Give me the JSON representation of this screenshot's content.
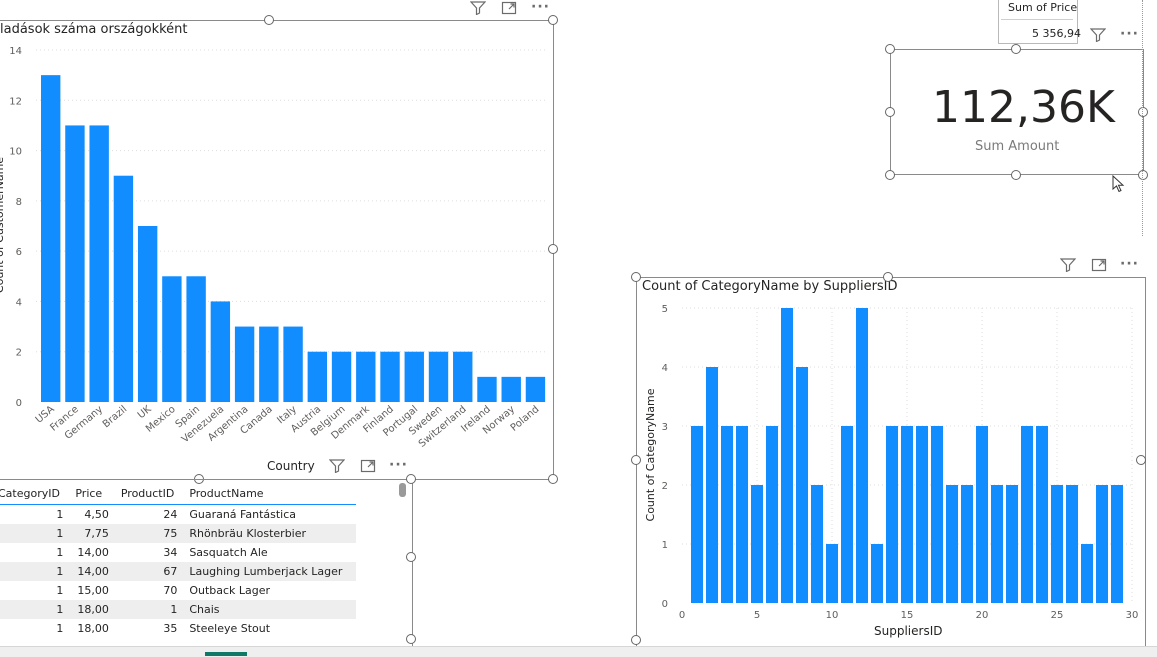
{
  "colors": {
    "bar": "#118dff",
    "accent": "#118dff"
  },
  "left_chart": {
    "title": "ladások száma országokként",
    "xlabel": "Country",
    "ylabel": "Count of CustomerName"
  },
  "kpi": {
    "value": "112,36K",
    "label": "Sum Amount"
  },
  "price_card": {
    "header": "Sum of Price",
    "value": "5 356,94"
  },
  "right_chart": {
    "title": "Count of CategoryName by SuppliersID",
    "xlabel": "SuppliersID",
    "ylabel": "Count of CategoryName"
  },
  "table": {
    "headers": [
      "CategoryID",
      "Price",
      "ProductID",
      "ProductName"
    ],
    "rows": [
      [
        "1",
        "4,50",
        "24",
        "Guaraná Fantástica"
      ],
      [
        "1",
        "7,75",
        "75",
        "Rhönbräu Klosterbier"
      ],
      [
        "1",
        "14,00",
        "34",
        "Sasquatch Ale"
      ],
      [
        "1",
        "14,00",
        "67",
        "Laughing Lumberjack Lager"
      ],
      [
        "1",
        "15,00",
        "70",
        "Outback Lager"
      ],
      [
        "1",
        "18,00",
        "1",
        "Chais"
      ],
      [
        "1",
        "18,00",
        "35",
        "Steeleye Stout"
      ]
    ]
  },
  "icons": [
    "filter-icon",
    "focus-mode-icon",
    "more-options-icon",
    "mouse-cursor-icon"
  ],
  "chart_data": [
    {
      "type": "bar",
      "title": "ladások száma országokként",
      "xlabel": "Country",
      "ylabel": "Count of CustomerName",
      "categories": [
        "USA",
        "France",
        "Germany",
        "Brazil",
        "UK",
        "Mexico",
        "Spain",
        "Venezuela",
        "Argentina",
        "Canada",
        "Italy",
        "Austria",
        "Belgium",
        "Denmark",
        "Finland",
        "Portugal",
        "Sweden",
        "Switzerland",
        "Ireland",
        "Norway",
        "Poland"
      ],
      "values": [
        13,
        11,
        11,
        9,
        7,
        5,
        5,
        4,
        3,
        3,
        3,
        2,
        2,
        2,
        2,
        2,
        2,
        2,
        1,
        1,
        1
      ],
      "ylim": [
        0,
        14
      ],
      "yticks": [
        0,
        2,
        4,
        6,
        8,
        10,
        12,
        14
      ],
      "grid": true
    },
    {
      "type": "bar",
      "title": "Count of CategoryName by SuppliersID",
      "xlabel": "SuppliersID",
      "ylabel": "Count of CategoryName",
      "x": [
        1,
        2,
        3,
        4,
        5,
        6,
        7,
        8,
        9,
        10,
        11,
        12,
        13,
        14,
        15,
        16,
        17,
        18,
        19,
        20,
        21,
        22,
        23,
        24,
        25,
        26,
        27,
        28,
        29
      ],
      "values": [
        3,
        4,
        3,
        3,
        2,
        3,
        5,
        4,
        2,
        1,
        3,
        5,
        1,
        3,
        3,
        3,
        3,
        2,
        2,
        3,
        2,
        2,
        3,
        3,
        2,
        2,
        1,
        2,
        2
      ],
      "xlim": [
        0,
        30
      ],
      "xticks": [
        0,
        5,
        10,
        15,
        20,
        25,
        30
      ],
      "ylim": [
        0,
        5
      ],
      "yticks": [
        0,
        1,
        2,
        3,
        4,
        5
      ],
      "grid": true
    }
  ]
}
